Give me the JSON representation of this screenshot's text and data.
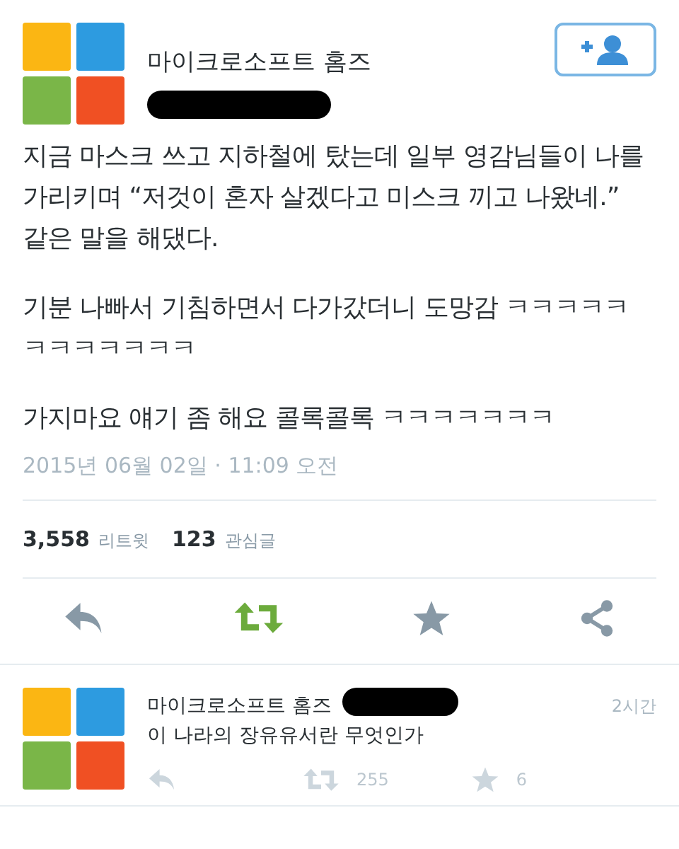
{
  "tweet": {
    "author": "마이크로소프트 홈즈",
    "paragraphs": [
      "지금 마스크 쓰고 지하철에 탔는데 일부 영감님들이 나를 가리키며 “저것이 혼자 살겠다고 미스크 끼고 나왔네.” 같은 말을 해댔다.",
      "기분 나빠서 기침하면서 다가갔더니 도망감 ㅋㅋㅋㅋㅋㅋㅋㅋㅋㅋㅋㅋ",
      "가지마요 얘기 좀 해요 콜록콜록 ㅋㅋㅋㅋㅋㅋㅋ"
    ],
    "timestamp": "2015년 06월 02일 · 11:09 오전",
    "stats": [
      {
        "count": "3,558",
        "label": "리트윗"
      },
      {
        "count": "123",
        "label": "관심글"
      }
    ],
    "retweeted": true
  },
  "reply": {
    "author": "마이크로소프트 홈즈",
    "time": "2시간",
    "text": "이 나라의 장유유서란 무엇인가",
    "retweets": "255",
    "likes": "6"
  }
}
